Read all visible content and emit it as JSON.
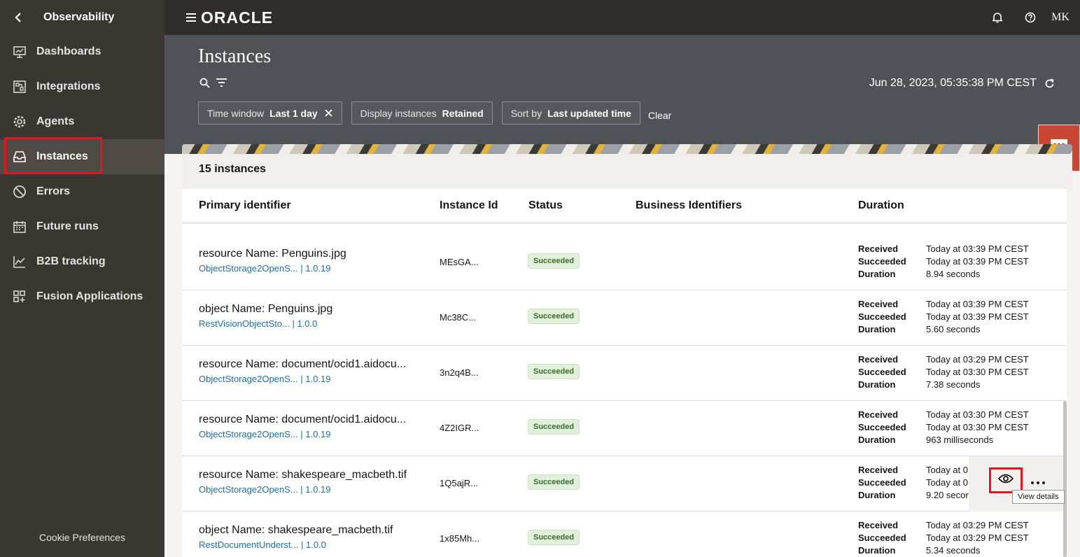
{
  "sidebar": {
    "title": "Observability",
    "items": [
      {
        "label": "Dashboards",
        "icon": "dashboard-icon"
      },
      {
        "label": "Integrations",
        "icon": "integrations-icon"
      },
      {
        "label": "Agents",
        "icon": "agents-icon"
      },
      {
        "label": "Instances",
        "icon": "instances-icon",
        "active": true
      },
      {
        "label": "Errors",
        "icon": "errors-icon"
      },
      {
        "label": "Future runs",
        "icon": "calendar-icon"
      },
      {
        "label": "B2B tracking",
        "icon": "b2b-icon"
      },
      {
        "label": "Fusion Applications",
        "icon": "fusion-icon"
      }
    ],
    "cookie": "Cookie Preferences"
  },
  "topbar": {
    "logo": "ORACLE",
    "user_initials": "MK"
  },
  "header": {
    "title": "Instances",
    "timestamp": "Jun 28, 2023, 05:35:38 PM CEST",
    "filters": [
      {
        "label": "Time window",
        "value": "Last 1 day"
      },
      {
        "label": "Display instances",
        "value": "Retained"
      },
      {
        "label": "Sort by",
        "value": "Last updated time"
      }
    ],
    "clear_label": "Clear"
  },
  "summary": {
    "count_text": "15 instances"
  },
  "table": {
    "columns": [
      "Primary identifier",
      "Instance Id",
      "Status",
      "Business Identifiers",
      "Duration"
    ],
    "duration_keys": {
      "received": "Received",
      "succeeded": "Succeeded",
      "duration": "Duration"
    },
    "rows": [
      {
        "primary": "resource Name: Penguins.jpg",
        "integration": "ObjectStorage2OpenS...",
        "version": "1.0.19",
        "instance_id": "MEsGA...",
        "status": "Succeeded",
        "received": "Today at 03:39 PM CEST",
        "succeeded": "Today at 03:39 PM CEST",
        "duration": "8.94 seconds"
      },
      {
        "primary": "object Name: Penguins.jpg",
        "integration": "RestVisionObjectSto...",
        "version": "1.0.0",
        "instance_id": "Mc38C...",
        "status": "Succeeded",
        "received": "Today at 03:39 PM CEST",
        "succeeded": "Today at 03:39 PM CEST",
        "duration": "5.60 seconds"
      },
      {
        "primary": "resource Name: document/ocid1.aidocu...",
        "integration": "ObjectStorage2OpenS...",
        "version": "1.0.19",
        "instance_id": "3n2q4B...",
        "status": "Succeeded",
        "received": "Today at 03:29 PM CEST",
        "succeeded": "Today at 03:30 PM CEST",
        "duration": "7.38 seconds"
      },
      {
        "primary": "resource Name: document/ocid1.aidocu...",
        "integration": "ObjectStorage2OpenS...",
        "version": "1.0.19",
        "instance_id": "4Z2IGR...",
        "status": "Succeeded",
        "received": "Today at 03:30 PM CEST",
        "succeeded": "Today at 03:30 PM CEST",
        "duration": "963 milliseconds"
      },
      {
        "primary": "resource Name: shakespeare_macbeth.tif",
        "integration": "ObjectStorage2OpenS...",
        "version": "1.0.19",
        "instance_id": "1Q5ajR...",
        "status": "Succeeded",
        "received": "Today at 0",
        "succeeded": "Today at 0",
        "duration": "9.20 secor"
      },
      {
        "primary": "object Name: shakespeare_macbeth.tif",
        "integration": "RestDocumentUnderst...",
        "version": "1.0.0",
        "instance_id": "1x85Mh...",
        "status": "Succeeded",
        "received": "Today at 03:29 PM CEST",
        "succeeded": "Today at 03:29 PM CEST",
        "duration": "5.34 seconds"
      }
    ]
  },
  "tooltip": "View details",
  "colors": {
    "accent": "#c74634",
    "highlight": "#e2161c",
    "badge_bg": "#e1f0da",
    "link": "#1d6fa5"
  }
}
